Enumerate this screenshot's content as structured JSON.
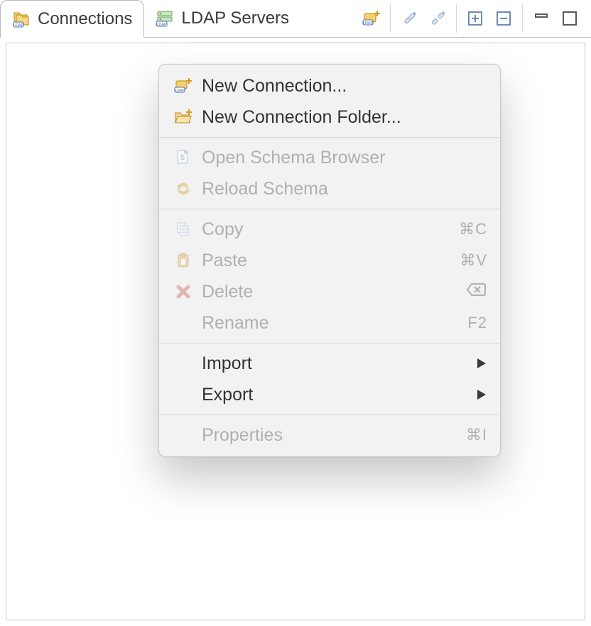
{
  "tabs": {
    "connections": {
      "label": "Connections"
    },
    "ldap_servers": {
      "label": "LDAP Servers"
    }
  },
  "context_menu": {
    "new_connection": {
      "label": "New Connection..."
    },
    "new_connection_folder": {
      "label": "New Connection Folder..."
    },
    "open_schema_browser": {
      "label": "Open Schema Browser"
    },
    "reload_schema": {
      "label": "Reload Schema"
    },
    "copy": {
      "label": "Copy",
      "accel": "⌘C"
    },
    "paste": {
      "label": "Paste",
      "accel": "⌘V"
    },
    "delete": {
      "label": "Delete",
      "accel": "⌫"
    },
    "rename": {
      "label": "Rename",
      "accel": "F2"
    },
    "import": {
      "label": "Import"
    },
    "export": {
      "label": "Export"
    },
    "properties": {
      "label": "Properties",
      "accel": "⌘I"
    }
  }
}
